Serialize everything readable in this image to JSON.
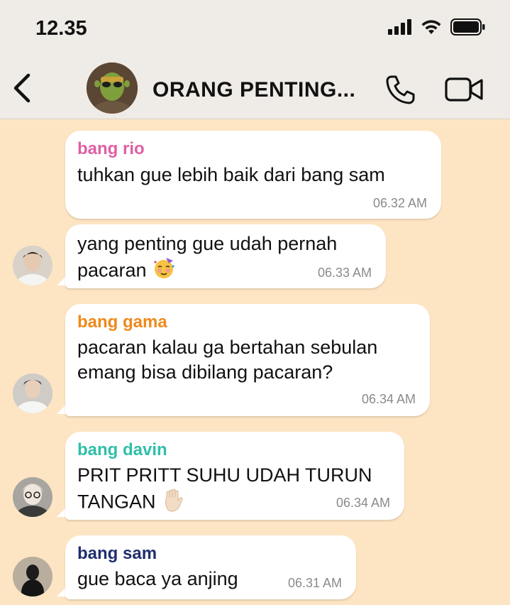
{
  "status_bar": {
    "time": "12.35"
  },
  "header": {
    "title": "ORANG PENTING..."
  },
  "colors": {
    "chat_bg": "#fde5c3",
    "bar_bg": "#efebe6",
    "rio": "#e05fa5",
    "gama": "#ef8a1c",
    "davin": "#2fbfa8",
    "sam": "#1f2e6e"
  },
  "messages": [
    {
      "sender": "bang rio",
      "lines": [
        "tuhkan gue lebih baik dari bang sam"
      ],
      "time": "06.32 AM"
    },
    {
      "sender": "",
      "lines": [
        "yang penting gue udah pernah",
        "pacaran"
      ],
      "emoji": "partying-face",
      "time": "06.33 AM"
    },
    {
      "sender": "bang gama",
      "lines": [
        "pacaran kalau ga bertahan sebulan",
        "emang bisa dibilang pacaran?"
      ],
      "time": "06.34 AM"
    },
    {
      "sender": "bang davin",
      "lines": [
        "PRIT PRITT SUHU UDAH TURUN",
        "TANGAN"
      ],
      "emoji": "raised-hand",
      "time": "06.34 AM"
    },
    {
      "sender": "bang sam",
      "lines": [
        "gue baca ya anjing"
      ],
      "time": "06.31 AM"
    }
  ]
}
